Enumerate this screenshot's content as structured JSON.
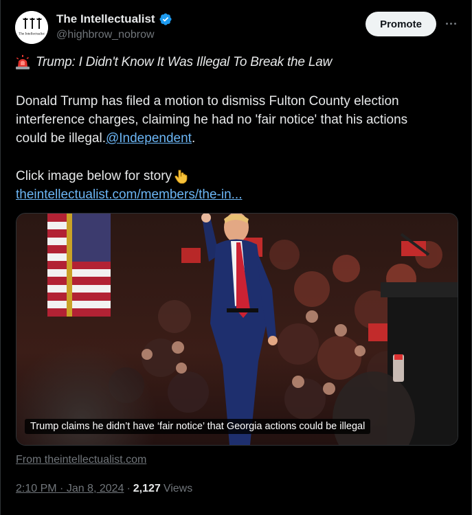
{
  "author": {
    "name": "The Intellectualist",
    "handle": "@highbrow_nobrow",
    "avatar_text": "The Intellectualist",
    "verified_icon": "verified-badge-icon"
  },
  "actions": {
    "promote_label": "Promote",
    "more_icon": "more-options-icon"
  },
  "post": {
    "headline": "Trump: I Didn't Know It Was Illegal To Break the Law",
    "headline_icon": "rotating-light-emoji",
    "body_lines": [
      "Donald Trump has filed a motion to dismiss Fulton County election",
      "interference charges, claiming he had no 'fair notice' that his actions",
      "could be illegal."
    ],
    "mention": "@Independent",
    "mention_suffix": ".",
    "click_text": "Click image below for story",
    "click_icon": "pointing-down-emoji",
    "link": "theintellectualist.com/members/the-in..."
  },
  "media": {
    "caption": "Trump claims he didn’t have ‘fair notice’ that Georgia actions could be illegal"
  },
  "footer": {
    "from_link": "From theintellectualist.com",
    "time": "2:10 PM",
    "date": "Jan 8, 2024",
    "views_count": "2,127",
    "views_label": "Views"
  },
  "colors": {
    "background": "#000000",
    "text": "#e7e9ea",
    "muted": "#71767b",
    "link": "#6cb6f5",
    "verified": "#1d9bf0"
  }
}
